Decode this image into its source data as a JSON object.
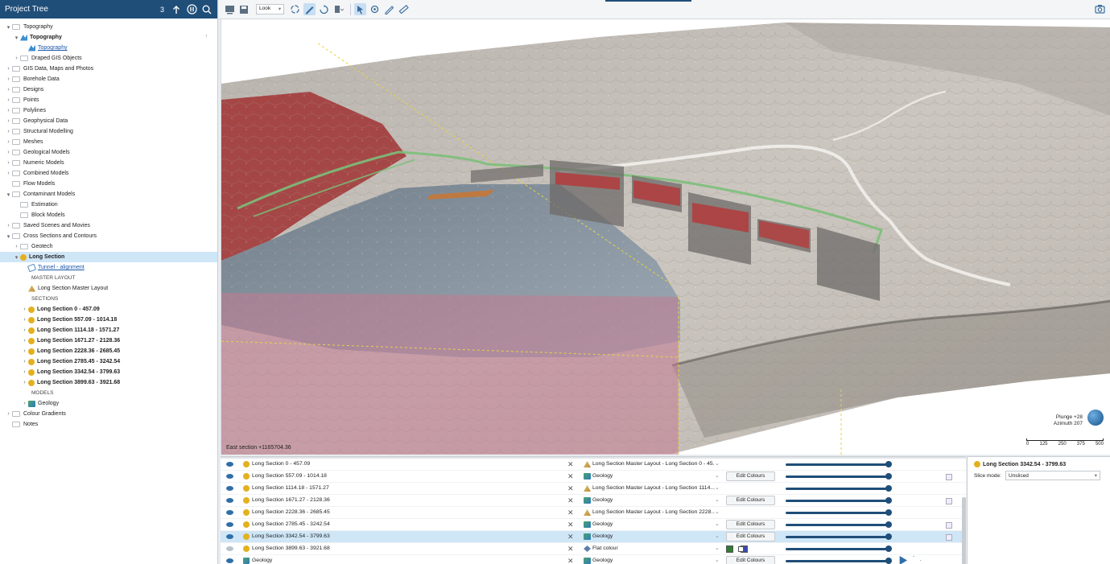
{
  "tree": {
    "title": "Project Tree",
    "count": "3",
    "items": [
      {
        "label": "Topography",
        "indent": 0,
        "chev": "⌄",
        "icon": "folder"
      },
      {
        "label": "Topography",
        "indent": 1,
        "chev": "⌄",
        "icon": "topo",
        "bold": true,
        "pin": true
      },
      {
        "label": "Topography",
        "indent": 2,
        "chev": "",
        "icon": "topo",
        "link": true
      },
      {
        "label": "Draped GIS Objects",
        "indent": 1,
        "chev": "›",
        "icon": "folder"
      },
      {
        "label": "GIS Data, Maps and Photos",
        "indent": 0,
        "chev": "›",
        "icon": "folder"
      },
      {
        "label": "Borehole Data",
        "indent": 0,
        "chev": "›",
        "icon": "folder"
      },
      {
        "label": "Designs",
        "indent": 0,
        "chev": "›",
        "icon": "folder"
      },
      {
        "label": "Points",
        "indent": 0,
        "chev": "›",
        "icon": "folder"
      },
      {
        "label": "Polylines",
        "indent": 0,
        "chev": "›",
        "icon": "folder"
      },
      {
        "label": "Geophysical Data",
        "indent": 0,
        "chev": "›",
        "icon": "folder"
      },
      {
        "label": "Structural Modelling",
        "indent": 0,
        "chev": "›",
        "icon": "folder"
      },
      {
        "label": "Meshes",
        "indent": 0,
        "chev": "›",
        "icon": "folder"
      },
      {
        "label": "Geological Models",
        "indent": 0,
        "chev": "›",
        "icon": "folder"
      },
      {
        "label": "Numeric Models",
        "indent": 0,
        "chev": "›",
        "icon": "folder"
      },
      {
        "label": "Combined Models",
        "indent": 0,
        "chev": "›",
        "icon": "folder"
      },
      {
        "label": "Flow Models",
        "indent": 0,
        "chev": "",
        "icon": "folder"
      },
      {
        "label": "Contaminant Models",
        "indent": 0,
        "chev": "⌄",
        "icon": "folder"
      },
      {
        "label": "Estimation",
        "indent": 1,
        "chev": "",
        "icon": "folder"
      },
      {
        "label": "Block Models",
        "indent": 1,
        "chev": "",
        "icon": "folder"
      },
      {
        "label": "Saved Scenes and Movies",
        "indent": 0,
        "chev": "›",
        "icon": "folder"
      },
      {
        "label": "Cross Sections and Contours",
        "indent": 0,
        "chev": "⌄",
        "icon": "folder"
      },
      {
        "label": "Geotech",
        "indent": 1,
        "chev": "›",
        "icon": "folder"
      },
      {
        "label": "Long Section",
        "indent": 1,
        "chev": "⌄",
        "icon": "sect",
        "bold": true,
        "selected": true
      },
      {
        "label": "Tunnel - alignment",
        "indent": 2,
        "chev": "",
        "icon": "poly",
        "link": true
      },
      {
        "label": "MASTER LAYOUT",
        "indent": 2,
        "chev": "",
        "icon": "none",
        "section": true
      },
      {
        "label": "Long Section Master Layout",
        "indent": 2,
        "chev": "",
        "icon": "layout"
      },
      {
        "label": "SECTIONS",
        "indent": 2,
        "chev": "",
        "icon": "none",
        "section": true
      },
      {
        "label": "Long Section 0 - 457.09",
        "indent": 2,
        "chev": "›",
        "icon": "sect",
        "bold": true
      },
      {
        "label": "Long Section 557.09 - 1014.18",
        "indent": 2,
        "chev": "›",
        "icon": "sect",
        "bold": true
      },
      {
        "label": "Long Section 1114.18 - 1571.27",
        "indent": 2,
        "chev": "›",
        "icon": "sect",
        "bold": true
      },
      {
        "label": "Long Section 1671.27 - 2128.36",
        "indent": 2,
        "chev": "›",
        "icon": "sect",
        "bold": true
      },
      {
        "label": "Long Section 2228.36 - 2685.45",
        "indent": 2,
        "chev": "›",
        "icon": "sect",
        "bold": true
      },
      {
        "label": "Long Section 2785.45 - 3242.54",
        "indent": 2,
        "chev": "›",
        "icon": "sect",
        "bold": true
      },
      {
        "label": "Long Section 3342.54 - 3799.63",
        "indent": 2,
        "chev": "›",
        "icon": "sect",
        "bold": true
      },
      {
        "label": "Long Section 3899.63 - 3921.68",
        "indent": 2,
        "chev": "›",
        "icon": "sect",
        "bold": true
      },
      {
        "label": "MODELS",
        "indent": 2,
        "chev": "",
        "icon": "none",
        "section": true
      },
      {
        "label": "Geology",
        "indent": 2,
        "chev": "›",
        "icon": "geo"
      },
      {
        "label": "Colour Gradients",
        "indent": 0,
        "chev": "›",
        "icon": "folder"
      },
      {
        "label": "Notes",
        "indent": 0,
        "chev": "",
        "icon": "folder"
      }
    ]
  },
  "toolbar": {
    "look_select": "Look",
    "icons": [
      "scene-view-icon",
      "save-scene-icon",
      "rotate-icon",
      "draw-icon",
      "slice-icon",
      "box-icon",
      "select-icon",
      "edit-icon",
      "measure-icon",
      "ruler-icon"
    ]
  },
  "viewport": {
    "coord_readout": "East section +1165704.36",
    "plunge": "Plunge +28",
    "azimuth": "Azimuth 207",
    "scale_ticks": [
      "0",
      "125",
      "250",
      "375",
      "500"
    ]
  },
  "scene_list": [
    {
      "name": "Long Section 0 - 457.09",
      "icon": "sect",
      "visible": true,
      "colouring": "Long Section Master Layout - Long Section 0 - 45...",
      "colicon": "layout",
      "edit": "",
      "slider": 1.0,
      "legend": false
    },
    {
      "name": "Long Section 557.09 - 1014.18",
      "icon": "sect",
      "visible": true,
      "colouring": "Geology",
      "colicon": "geo",
      "edit": "Edit Colours",
      "slider": 1.0,
      "legend": true
    },
    {
      "name": "Long Section 1114.18 - 1571.27",
      "icon": "sect",
      "visible": true,
      "colouring": "Long Section Master Layout - Long Section 1114...",
      "colicon": "layout",
      "edit": "",
      "slider": 1.0,
      "legend": false
    },
    {
      "name": "Long Section 1671.27 - 2128.36",
      "icon": "sect",
      "visible": true,
      "colouring": "Geology",
      "colicon": "geo",
      "edit": "Edit Colours",
      "slider": 1.0,
      "legend": true
    },
    {
      "name": "Long Section 2228.36 - 2685.45",
      "icon": "sect",
      "visible": true,
      "colouring": "Long Section Master Layout - Long Section 2228...",
      "colicon": "layout",
      "edit": "",
      "slider": 1.0,
      "legend": false
    },
    {
      "name": "Long Section 2785.45 - 3242.54",
      "icon": "sect",
      "visible": true,
      "colouring": "Geology",
      "colicon": "geo",
      "edit": "Edit Colours",
      "slider": 1.0,
      "legend": true
    },
    {
      "name": "Long Section 3342.54 - 3799.63",
      "icon": "sect",
      "visible": true,
      "colouring": "Geology",
      "colicon": "geo",
      "edit": "Edit Colours",
      "slider": 1.0,
      "legend": true,
      "selected": true
    },
    {
      "name": "Long Section 3899.63 - 3921.68",
      "icon": "sect",
      "visible": false,
      "colouring": "Flat colour",
      "colicon": "flat",
      "edit": "",
      "slider": 1.0,
      "legend": false,
      "swatches": [
        "#2e7d32",
        "#3949ab"
      ]
    },
    {
      "name": "Geology",
      "icon": "geo",
      "visible": true,
      "colouring": "Geology",
      "colicon": "geo",
      "edit": "Edit Colours",
      "slider": 1.0,
      "legend": false,
      "play": true
    }
  ],
  "properties": {
    "title": "Long Section 3342.54 - 3799.63",
    "slice_label": "Slice mode:",
    "slice_value": "Unsliced"
  },
  "colors": {
    "header": "#1f4e79",
    "selection": "#cfe6f7",
    "accent": "#2f6ea8"
  }
}
